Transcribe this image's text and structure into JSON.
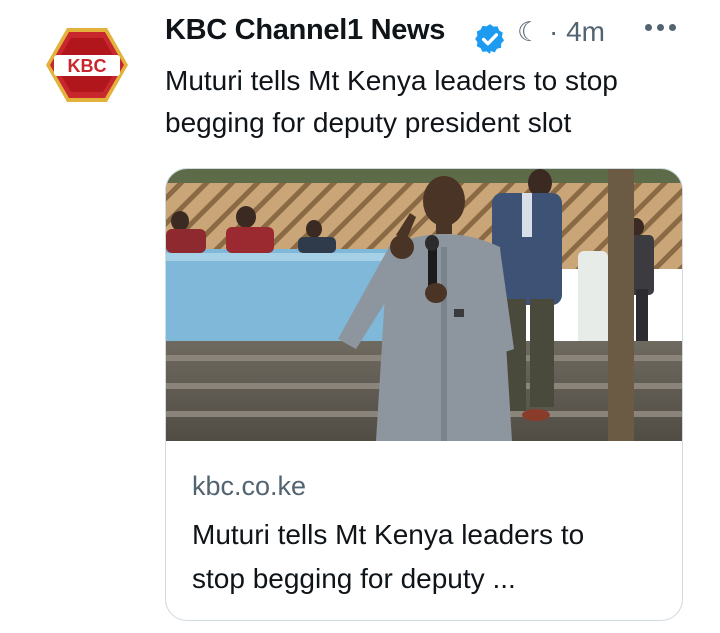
{
  "tweet": {
    "author": {
      "name": "KBC Channel1 News",
      "verified": true,
      "avatar_icon": "kbc-logo",
      "avatar_text": "KBC"
    },
    "meta": {
      "status_mark": "☾",
      "separator": "·",
      "time": "4m"
    },
    "more_icon": "more-horizontal-icon",
    "text_lines": [
      "Muturi tells Mt Kenya leaders to stop",
      "begging for deputy president slot"
    ],
    "card": {
      "image": "photo-man-speaking-into-microphone",
      "domain": "kbc.co.ke",
      "title_lines": [
        "Muturi tells Mt Kenya leaders to",
        "stop begging for deputy ..."
      ]
    }
  },
  "colors": {
    "text_primary": "#0f1419",
    "text_secondary": "#536471",
    "verified_blue": "#1d9bf0",
    "border": "#cfd9de",
    "logo_red": "#c8282d",
    "logo_gold": "#e2b23a"
  }
}
